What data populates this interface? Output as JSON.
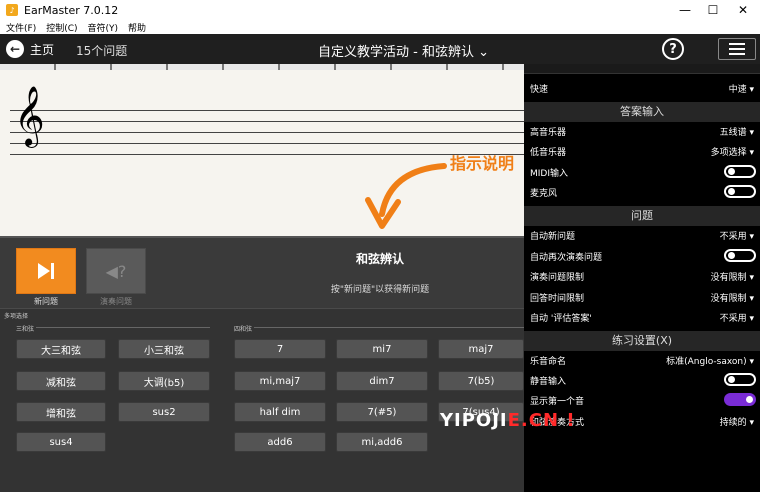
{
  "window": {
    "title": "EarMaster 7.0.12",
    "minimize": "—",
    "maximize": "☐",
    "close": "✕"
  },
  "menubar": {
    "items": [
      "文件(F)",
      "控制(C)",
      "音符(Y)",
      "帮助"
    ]
  },
  "header": {
    "home_icon": "back-arrow-icon",
    "home_label": "主页",
    "question_count": "15个问题",
    "title": "自定义教学活动 - 和弦辨认",
    "help_label": "?",
    "menu_icon": "hamburger-icon"
  },
  "staff": {
    "clef": "𝄞",
    "annotation": "指示说明"
  },
  "control": {
    "new_label": "新问题",
    "replay_label": "演奏问题",
    "exercise_name": "和弦辨认",
    "hint": "按\"新问题\"以获得新问题"
  },
  "answers": {
    "title": "多项选择",
    "triads_label": "三和弦",
    "sevenths_label": "四和弦",
    "triads": [
      "大三和弦",
      "小三和弦",
      "减和弦",
      "大调(b5)",
      "增和弦",
      "sus2",
      "sus4"
    ],
    "sevenths": [
      "7",
      "mi7",
      "maj7",
      "mi,maj7",
      "dim7",
      "7(b5)",
      "half dim",
      "7(#5)",
      "7(sus4)",
      "add6",
      "mi,add6"
    ]
  },
  "settings": {
    "speed_label": "快速",
    "speed_value": "中速",
    "answer_section": "答案输入",
    "treble_label": "高音乐器",
    "treble_value": "五线谱",
    "bass_label": "低音乐器",
    "bass_value": "多项选择",
    "midi_label": "MIDI输入",
    "mic_label": "麦克风",
    "question_section": "问题",
    "autonew_label": "自动新问题",
    "autonew_value": "不采用",
    "autoreplay_label": "自动再次演奏问题",
    "playlimit_label": "演奏问题限制",
    "playlimit_value": "没有限制",
    "timelimit_label": "回答时间限制",
    "timelimit_value": "没有限制",
    "autoeval_label": "自动 '评估答案'",
    "autoeval_value": "不采用",
    "practice_section": "练习设置(X)",
    "naming_label": "乐音命名",
    "naming_value": "标准(Anglo-saxon)",
    "mute_label": "静音输入",
    "showfirst_label": "显示第一个音",
    "playmode_label": "和弦演奏方式",
    "playmode_value": "持续的"
  },
  "watermark": {
    "prefix": "YIPOJI",
    "accent": "E.CN",
    "suffix": "!"
  },
  "colors": {
    "accent_orange": "#f28b1f",
    "toggle_on": "#7a2cd6",
    "panel_bg": "#000000"
  }
}
